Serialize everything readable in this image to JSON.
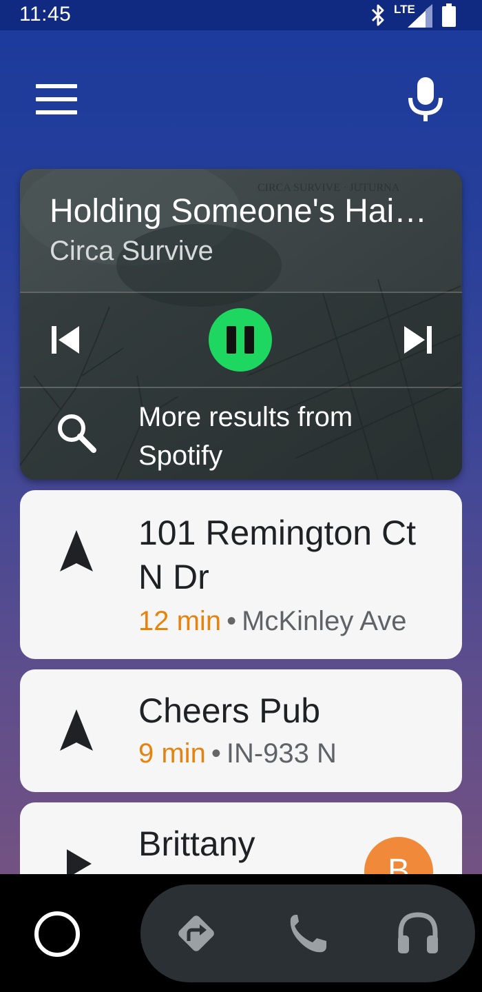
{
  "status_bar": {
    "time": "11:45",
    "network": "LTE",
    "icons": [
      "bluetooth-icon",
      "lte-signal-icon",
      "battery-icon"
    ]
  },
  "top_bar": {
    "menu_icon": "menu-icon",
    "voice_icon": "mic-icon"
  },
  "media": {
    "title": "Holding Someone's Hai…",
    "artist": "Circa Survive",
    "album_watermark": "CIRCA SURVIVE · JUTURNA",
    "controls": [
      "skip-previous-icon",
      "pause-icon",
      "skip-next-icon"
    ],
    "accent_color": "#1ed760",
    "more_results_label": "More results from Spotify"
  },
  "suggestions": [
    {
      "title": "101 Remington Ct N Dr",
      "eta": "12 min",
      "separator": "•",
      "street": "McKinley Ave",
      "icon": "navigation-arrow-icon"
    },
    {
      "title": "Cheers Pub",
      "eta": "9 min",
      "separator": "•",
      "street": "IN-933 N",
      "icon": "navigation-arrow-icon"
    },
    {
      "title": "Brittany",
      "icon": "play-icon",
      "avatar_letter": "B",
      "avatar_color": "#f08a3a"
    }
  ],
  "bottom_nav": {
    "items": [
      "home-icon",
      "navigation-icon",
      "phone-icon",
      "headphones-icon"
    ]
  },
  "colors": {
    "eta": "#e8820c",
    "status_bar": "#0f2a80",
    "card_bg": "#f6f6f6"
  }
}
